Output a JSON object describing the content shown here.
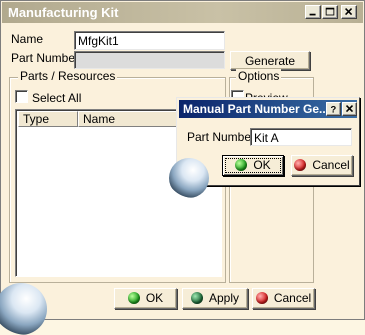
{
  "window": {
    "title": "Manufacturing Kit",
    "title_buttons": {
      "minimize": "minimize-icon",
      "maximize": "maximize-icon",
      "close": "close-icon"
    }
  },
  "form": {
    "name_label": "Name",
    "name_value": "MfgKit1",
    "part_number_label": "Part Number",
    "part_number_value": "",
    "generate_label": "Generate"
  },
  "parts_group": {
    "legend": "Parts / Resources",
    "select_all_label": "Select All",
    "columns": [
      "Type",
      "Name"
    ]
  },
  "options_group": {
    "legend": "Options",
    "preview_label": "Preview"
  },
  "footer": {
    "ok_label": "OK",
    "apply_label": "Apply",
    "cancel_label": "Cancel"
  },
  "dialog": {
    "title": "Manual Part Number Ge...",
    "help_icon": "question-icon",
    "close_icon": "close-icon",
    "part_number_label": "Part Number",
    "part_number_value": "Kit A",
    "ok_label": "OK",
    "cancel_label": "Cancel"
  },
  "colors": {
    "title_active": "#0a246a",
    "title_inactive": "#b1a98e",
    "window_bg": "#fbf1dc",
    "ok_dot": "#20a020",
    "apply_dot": "#1f6b3a",
    "cancel_dot": "#d42020"
  }
}
